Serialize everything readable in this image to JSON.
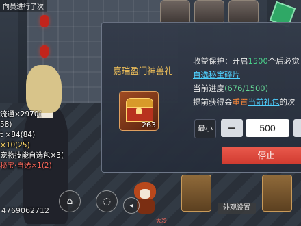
{
  "scene": {
    "top_left_text": "向员进行了次",
    "chat": [
      {
        "text": "流通×2970(",
        "style": ""
      },
      {
        "text": "58)",
        "style": ""
      },
      {
        "text": "t ×84(84)",
        "style": ""
      },
      {
        "text": "×10(25)",
        "style": "yel"
      },
      {
        "text": "宠物技能自选包×3(",
        "style": ""
      },
      {
        "text": "秘宝·自选×1(2)",
        "style": "red"
      }
    ],
    "uid": "4769062712",
    "appearance_label": "外观设置",
    "bottom_chip": "大冷"
  },
  "dialog": {
    "title": "嘉瑞盈门神兽礼",
    "item": {
      "name": "treasure-chest",
      "count": "263"
    },
    "protection": {
      "prefix": "收益保护：开启",
      "value": "1500",
      "suffix": "个后必觉"
    },
    "reward_link": "自选秘宝碎片",
    "progress": {
      "prefix": "当前进度",
      "value": "(676/1500)"
    },
    "hint": {
      "prefix": "提前获得会",
      "highlight": "重置",
      "mid": "当前礼包",
      "suffix": "的次"
    },
    "min_label": "最小",
    "quantity": "500",
    "stop_label": "停止"
  }
}
